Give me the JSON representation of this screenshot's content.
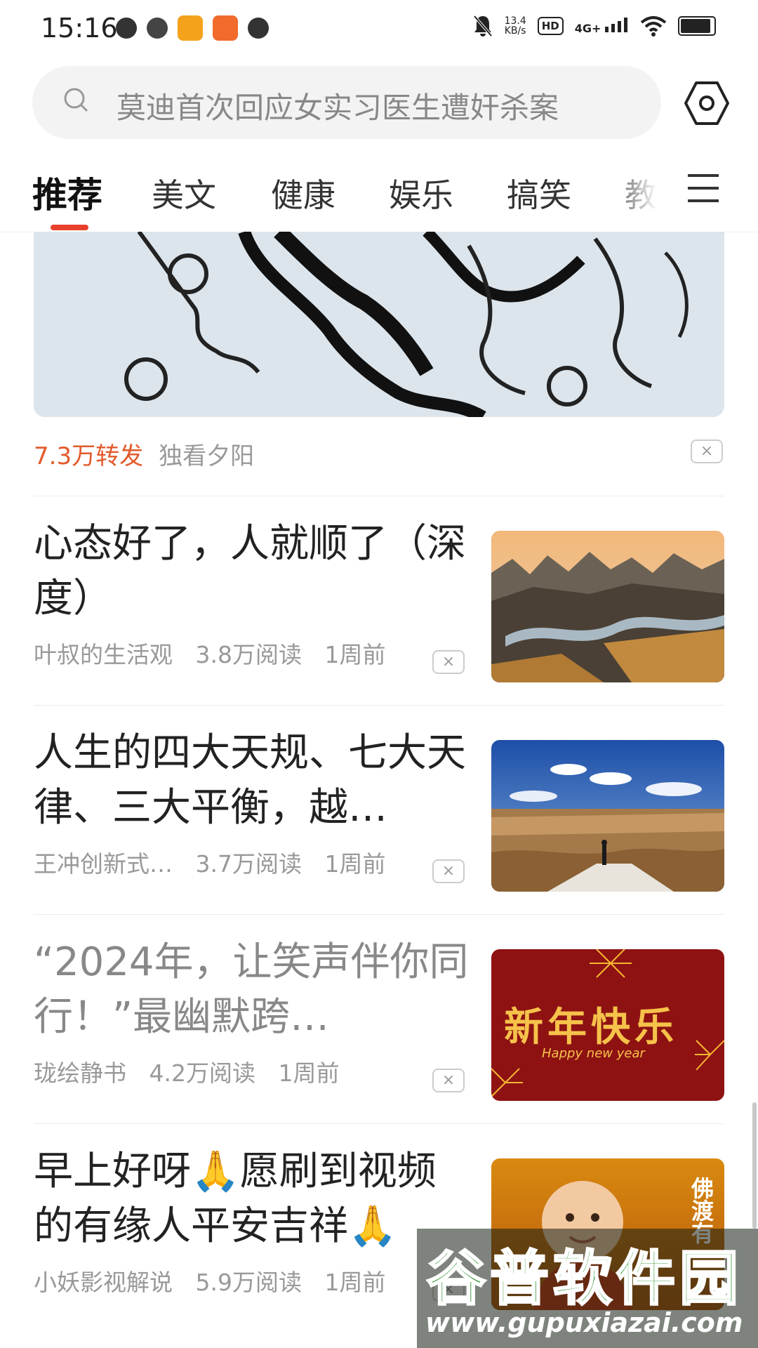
{
  "status_bar": {
    "time": "15:16",
    "net_speed_top": "13.4",
    "net_speed_bottom": "KB/s",
    "hd": "HD",
    "signal": "4G+"
  },
  "search": {
    "placeholder_text": "莫迪首次回应女实习医生遭奸杀案"
  },
  "tabs": [
    {
      "label": "推荐",
      "active": true
    },
    {
      "label": "美文"
    },
    {
      "label": "健康"
    },
    {
      "label": "娱乐"
    },
    {
      "label": "搞笑"
    },
    {
      "label": "教"
    }
  ],
  "top_card": {
    "shares": "7.3万转发",
    "author": "独看夕阳",
    "close": "×"
  },
  "articles": [
    {
      "title": "心态好了，人就顺了（深度）",
      "author": "叶叔的生活观",
      "reads": "3.8万阅读",
      "time": "1周前",
      "close": "×",
      "read": false
    },
    {
      "title": "人生的四大天规、七大天律、三大平衡，越…",
      "author": "王冲创新式…",
      "reads": "3.7万阅读",
      "time": "1周前",
      "close": "×",
      "read": false
    },
    {
      "title": "“2024年，让笑声伴你同行！”最幽默跨…",
      "author": "珑绘静书",
      "reads": "4.2万阅读",
      "time": "1周前",
      "close": "×",
      "read": true
    },
    {
      "title": "早上好呀🙏愿刷到视频的有缘人平安吉祥🙏",
      "author": "小妖影视解说",
      "reads": "5.9万阅读",
      "time": "1周前",
      "close": "×",
      "read": false
    }
  ],
  "thumb_texts": {
    "newyear_title": "新年快乐",
    "newyear_sub": "Happy new year",
    "buddha": "佛渡有"
  },
  "watermark": {
    "title": "谷普软件园",
    "url": "www.gupuxiazai.com"
  },
  "colors": {
    "accent": "#e9402d",
    "share_count": "#e25a2b"
  }
}
